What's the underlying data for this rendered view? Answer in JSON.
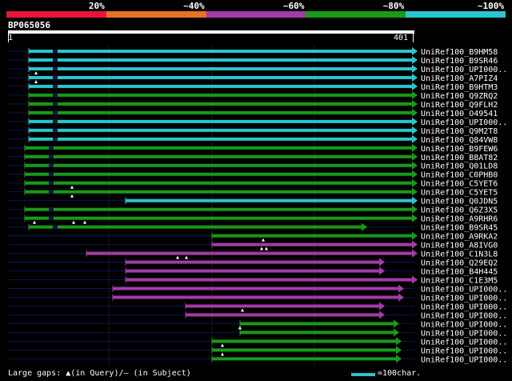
{
  "scale": {
    "segments": [
      {
        "color": "#e8153a",
        "label": "20%"
      },
      {
        "color": "#e8731f",
        "label": "~40%"
      },
      {
        "color": "#a23ca6",
        "label": "~60%"
      },
      {
        "color": "#1a9a1a",
        "label": "~80%"
      },
      {
        "color": "#29c6cd",
        "label": "~100%"
      }
    ]
  },
  "query": {
    "id": "BP065056",
    "start": "1",
    "end": "401"
  },
  "hits": [
    {
      "name": "UniRef100_B9HM58",
      "color": "#29c6cd"
    },
    {
      "name": "UniRef100_B9SR46",
      "color": "#29c6cd"
    },
    {
      "name": "UniRef100_UPI000..",
      "color": "#29c6cd"
    },
    {
      "name": "UniRef100_A7PIZ4",
      "color": "#29c6cd"
    },
    {
      "name": "UniRef100_B9HTM3",
      "color": "#29c6cd"
    },
    {
      "name": "UniRef100_Q9ZRQ2",
      "color": "#1a9a1a"
    },
    {
      "name": "UniRef100_Q9FLH2",
      "color": "#1a9a1a"
    },
    {
      "name": "UniRef100_O49541",
      "color": "#1a9a1a"
    },
    {
      "name": "UniRef100_UPI000..",
      "color": "#29c6cd"
    },
    {
      "name": "UniRef100_Q9M2T8",
      "color": "#29c6cd"
    },
    {
      "name": "UniRef100_Q84VW8",
      "color": "#29c6cd"
    },
    {
      "name": "UniRef100_B9FEW6",
      "color": "#1a9a1a"
    },
    {
      "name": "UniRef100_B8AT82",
      "color": "#1a9a1a"
    },
    {
      "name": "UniRef100_Q01LD8",
      "color": "#1a9a1a"
    },
    {
      "name": "UniRef100_C0PHB0",
      "color": "#1a9a1a"
    },
    {
      "name": "UniRef100_C5YET6",
      "color": "#1a9a1a"
    },
    {
      "name": "UniRef100_C5YET5",
      "color": "#1a9a1a"
    },
    {
      "name": "UniRef100_Q0JDN5",
      "color": "#29c6cd"
    },
    {
      "name": "UniRef100_Q6Z3X5",
      "color": "#1a9a1a"
    },
    {
      "name": "UniRef100_A9RHR6",
      "color": "#1a9a1a"
    },
    {
      "name": "UniRef100_B9SR45",
      "color": "#1a9a1a"
    },
    {
      "name": "UniRef100_A9RKA2",
      "color": "#1a9a1a"
    },
    {
      "name": "UniRef100_A8IVG0",
      "color": "#a23ca6"
    },
    {
      "name": "UniRef100_C1N3L8",
      "color": "#a23ca6"
    },
    {
      "name": "UniRef100_Q29EQ2",
      "color": "#a23ca6"
    },
    {
      "name": "UniRef100_B4H445",
      "color": "#a23ca6"
    },
    {
      "name": "UniRef100_C1E3M5",
      "color": "#a23ca6"
    },
    {
      "name": "UniRef100_UPI000..",
      "color": "#a23ca6"
    },
    {
      "name": "UniRef100_UPI000..",
      "color": "#a23ca6"
    },
    {
      "name": "UniRef100_UPI000..",
      "color": "#a23ca6"
    },
    {
      "name": "UniRef100_UPI000..",
      "color": "#a23ca6"
    },
    {
      "name": "UniRef100_UPI000..",
      "color": "#1a9a1a"
    },
    {
      "name": "UniRef100_UPI000..",
      "color": "#1a9a1a"
    },
    {
      "name": "UniRef100_UPI000..",
      "color": "#1a9a1a"
    },
    {
      "name": "UniRef100_UPI000..",
      "color": "#1a9a1a"
    },
    {
      "name": "UniRef100_UPI000..",
      "color": "#1a9a1a"
    }
  ],
  "legend": {
    "gaps_text": "Large gaps: ▲(in Query)/— (in Subject)",
    "scale_text": "=100char."
  }
}
